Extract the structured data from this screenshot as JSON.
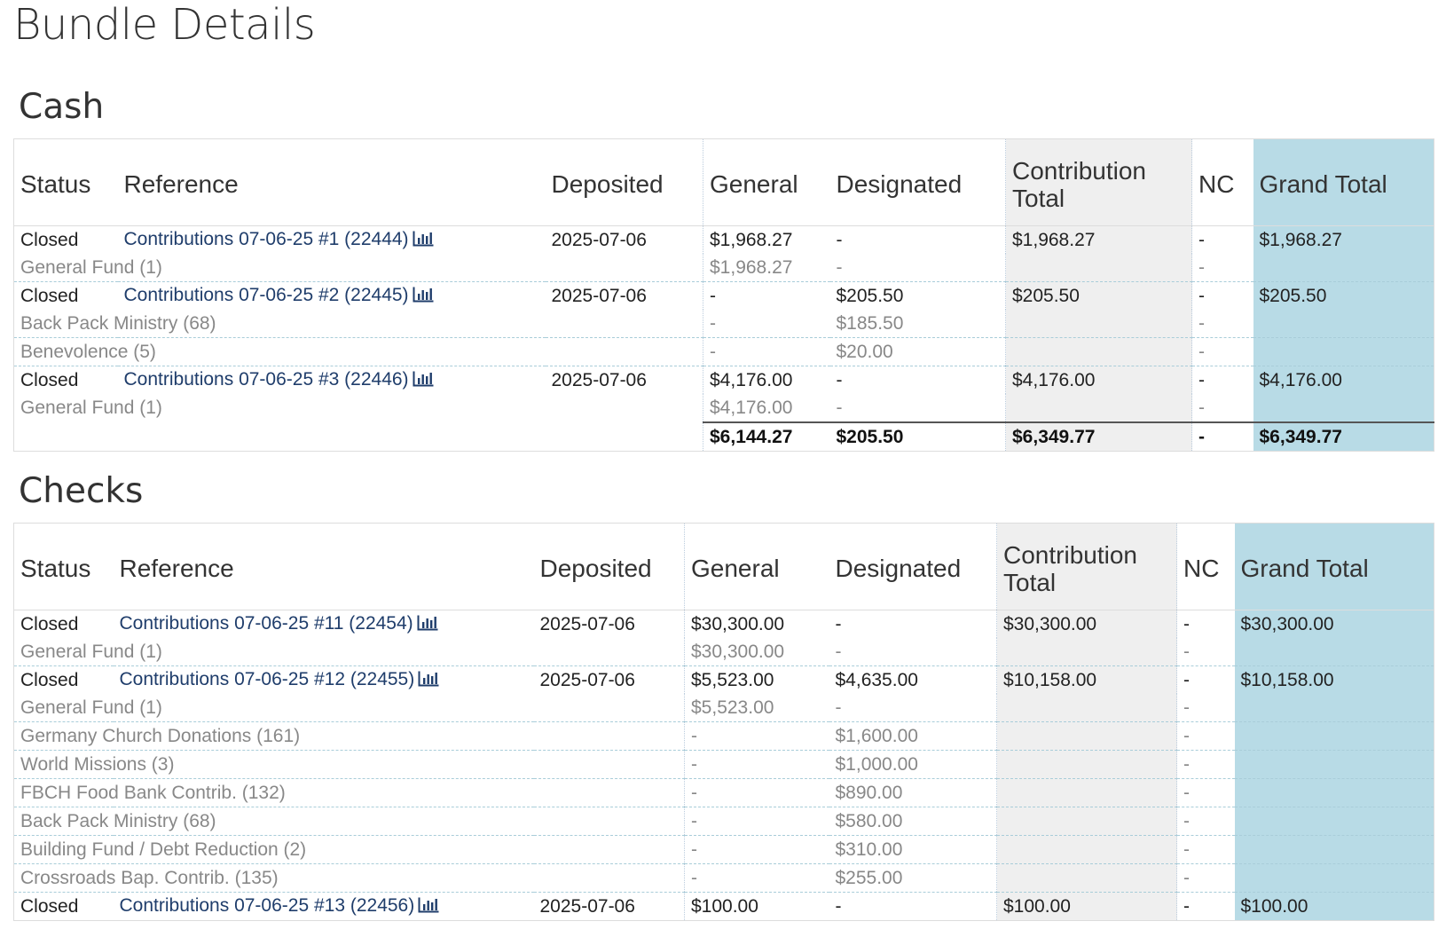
{
  "page": {
    "title": "Bundle Details"
  },
  "columns": {
    "status": "Status",
    "reference": "Reference",
    "deposited": "Deposited",
    "general": "General",
    "designated": "Designated",
    "contribution_total": "Contribution Total",
    "nc": "NC",
    "grand_total": "Grand Total"
  },
  "colors": {
    "link": "#1f3d6b",
    "grand_total_bg": "#b8dbe6",
    "contribution_total_bg": "#efefef",
    "subrow_text": "#888888"
  },
  "icons": {
    "reference_icon": "bar-chart-icon"
  },
  "sections": [
    {
      "title": "Cash",
      "bundles": [
        {
          "status": "Closed",
          "reference": "Contributions 07-06-25 #1 (22444)",
          "deposited": "2025-07-06",
          "general": "$1,968.27",
          "designated": "-",
          "contribution_total": "$1,968.27",
          "nc": "-",
          "grand_total": "$1,968.27",
          "funds": [
            {
              "name": "General Fund (1)",
              "general": "$1,968.27",
              "designated": "-",
              "nc": "-"
            }
          ]
        },
        {
          "status": "Closed",
          "reference": "Contributions 07-06-25 #2 (22445)",
          "deposited": "2025-07-06",
          "general": "-",
          "designated": "$205.50",
          "contribution_total": "$205.50",
          "nc": "-",
          "grand_total": "$205.50",
          "funds": [
            {
              "name": "Back Pack Ministry (68)",
              "general": "-",
              "designated": "$185.50",
              "nc": "-"
            },
            {
              "name": "Benevolence (5)",
              "general": "-",
              "designated": "$20.00",
              "nc": "-"
            }
          ]
        },
        {
          "status": "Closed",
          "reference": "Contributions 07-06-25 #3 (22446)",
          "deposited": "2025-07-06",
          "general": "$4,176.00",
          "designated": "-",
          "contribution_total": "$4,176.00",
          "nc": "-",
          "grand_total": "$4,176.00",
          "funds": [
            {
              "name": "General Fund (1)",
              "general": "$4,176.00",
              "designated": "-",
              "nc": "-"
            }
          ]
        }
      ],
      "totals": {
        "general": "$6,144.27",
        "designated": "$205.50",
        "contribution_total": "$6,349.77",
        "nc": "-",
        "grand_total": "$6,349.77"
      }
    },
    {
      "title": "Checks",
      "bundles": [
        {
          "status": "Closed",
          "reference": "Contributions 07-06-25 #11 (22454)",
          "deposited": "2025-07-06",
          "general": "$30,300.00",
          "designated": "-",
          "contribution_total": "$30,300.00",
          "nc": "-",
          "grand_total": "$30,300.00",
          "funds": [
            {
              "name": "General Fund (1)",
              "general": "$30,300.00",
              "designated": "-",
              "nc": "-"
            }
          ]
        },
        {
          "status": "Closed",
          "reference": "Contributions 07-06-25 #12 (22455)",
          "deposited": "2025-07-06",
          "general": "$5,523.00",
          "designated": "$4,635.00",
          "contribution_total": "$10,158.00",
          "nc": "-",
          "grand_total": "$10,158.00",
          "funds": [
            {
              "name": "General Fund (1)",
              "general": "$5,523.00",
              "designated": "-",
              "nc": "-"
            },
            {
              "name": "Germany Church Donations (161)",
              "general": "-",
              "designated": "$1,600.00",
              "nc": "-"
            },
            {
              "name": "World Missions (3)",
              "general": "-",
              "designated": "$1,000.00",
              "nc": "-"
            },
            {
              "name": "FBCH Food Bank Contrib. (132)",
              "general": "-",
              "designated": "$890.00",
              "nc": "-"
            },
            {
              "name": "Back Pack Ministry (68)",
              "general": "-",
              "designated": "$580.00",
              "nc": "-"
            },
            {
              "name": "Building Fund / Debt Reduction (2)",
              "general": "-",
              "designated": "$310.00",
              "nc": "-"
            },
            {
              "name": "Crossroads Bap. Contrib. (135)",
              "general": "-",
              "designated": "$255.00",
              "nc": "-"
            }
          ]
        },
        {
          "status": "Closed",
          "reference": "Contributions 07-06-25 #13 (22456)",
          "deposited": "2025-07-06",
          "general": "$100.00",
          "designated": "-",
          "contribution_total": "$100.00",
          "nc": "-",
          "grand_total": "$100.00",
          "funds": []
        }
      ]
    }
  ]
}
